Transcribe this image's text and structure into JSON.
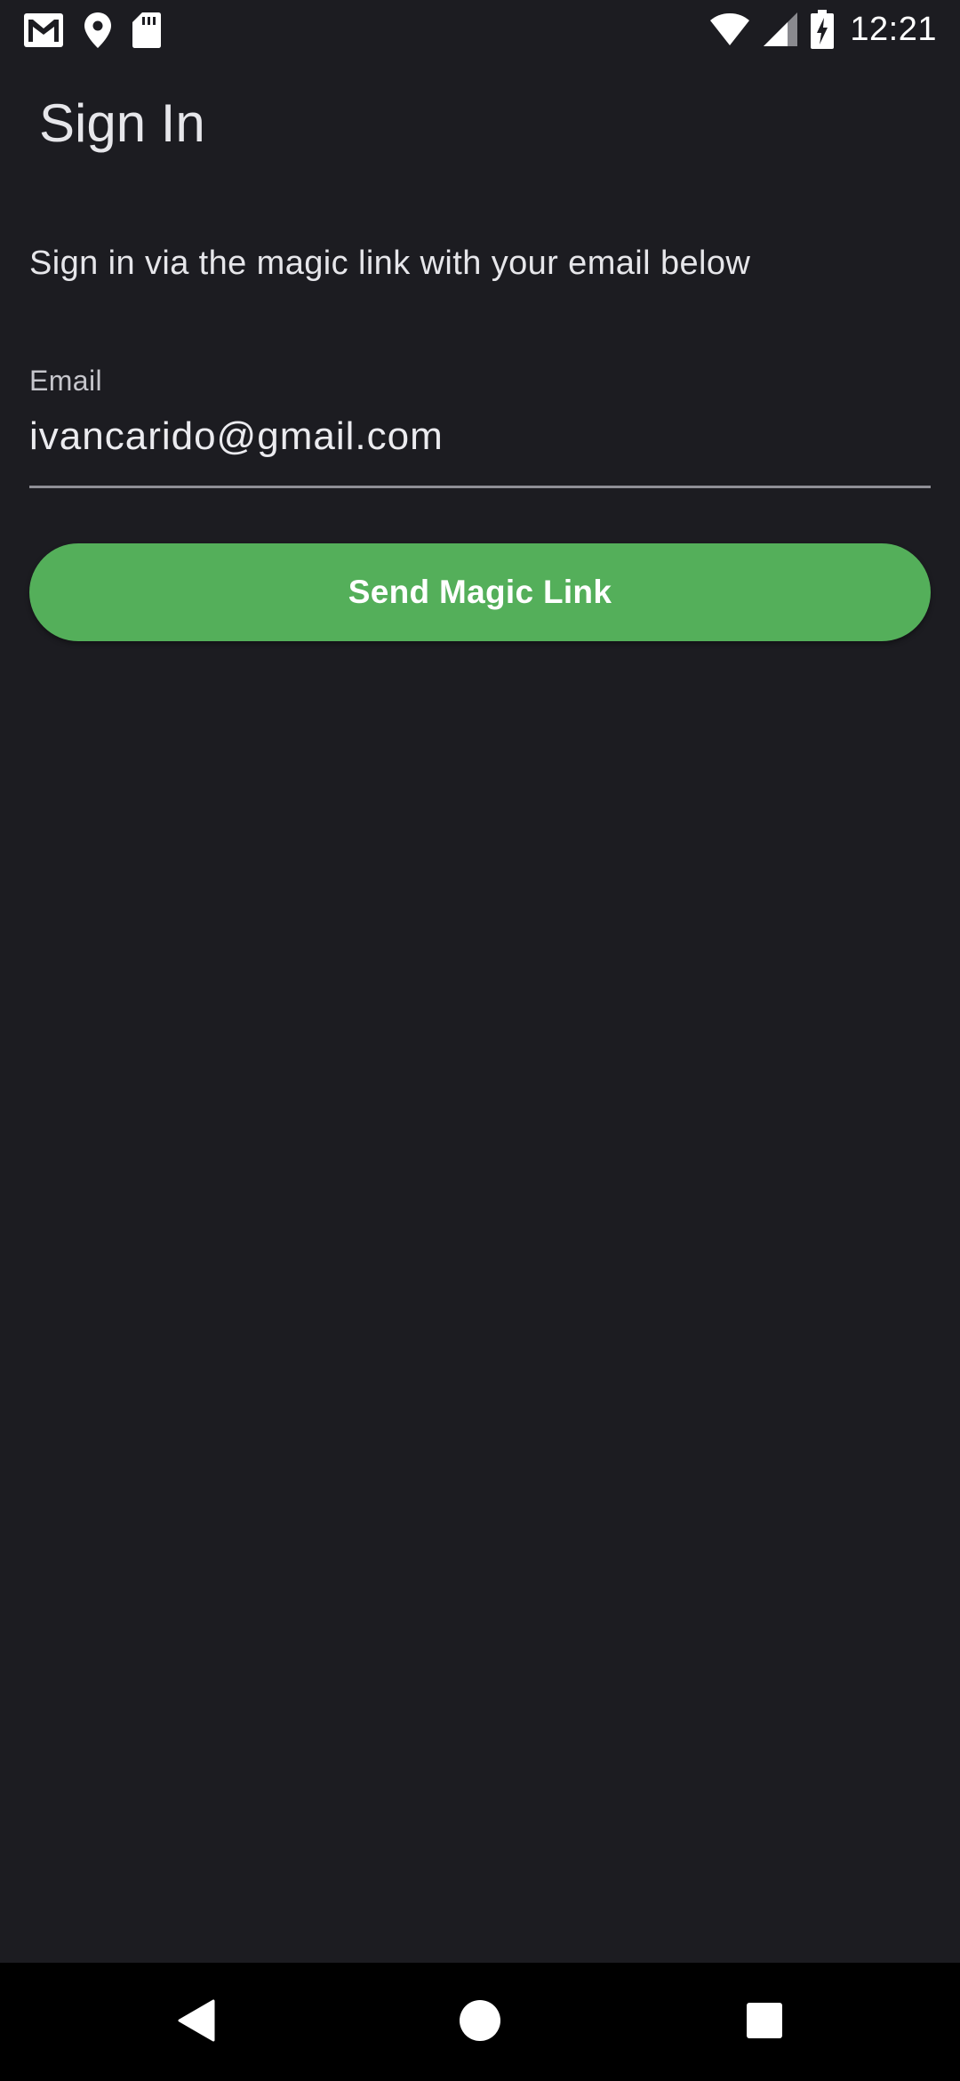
{
  "status_bar": {
    "time": "12:21",
    "left_icons": [
      "gmail-icon",
      "location-pin-icon",
      "sd-card-icon"
    ],
    "right_icons": [
      "wifi-icon",
      "cell-signal-icon",
      "battery-charging-icon"
    ]
  },
  "app_bar": {
    "title": "Sign In"
  },
  "main": {
    "instructions": "Sign in via the magic link with your email below",
    "email": {
      "label": "Email",
      "value": "ivancarido@gmail.com"
    },
    "send_button_label": "Send Magic Link"
  },
  "nav_bar": {
    "icons": [
      "back-icon",
      "home-icon",
      "recents-icon"
    ]
  },
  "colors": {
    "background": "#1c1c21",
    "accent": "#54af5a",
    "text": "#e6e6ea",
    "nav_background": "#000000"
  }
}
